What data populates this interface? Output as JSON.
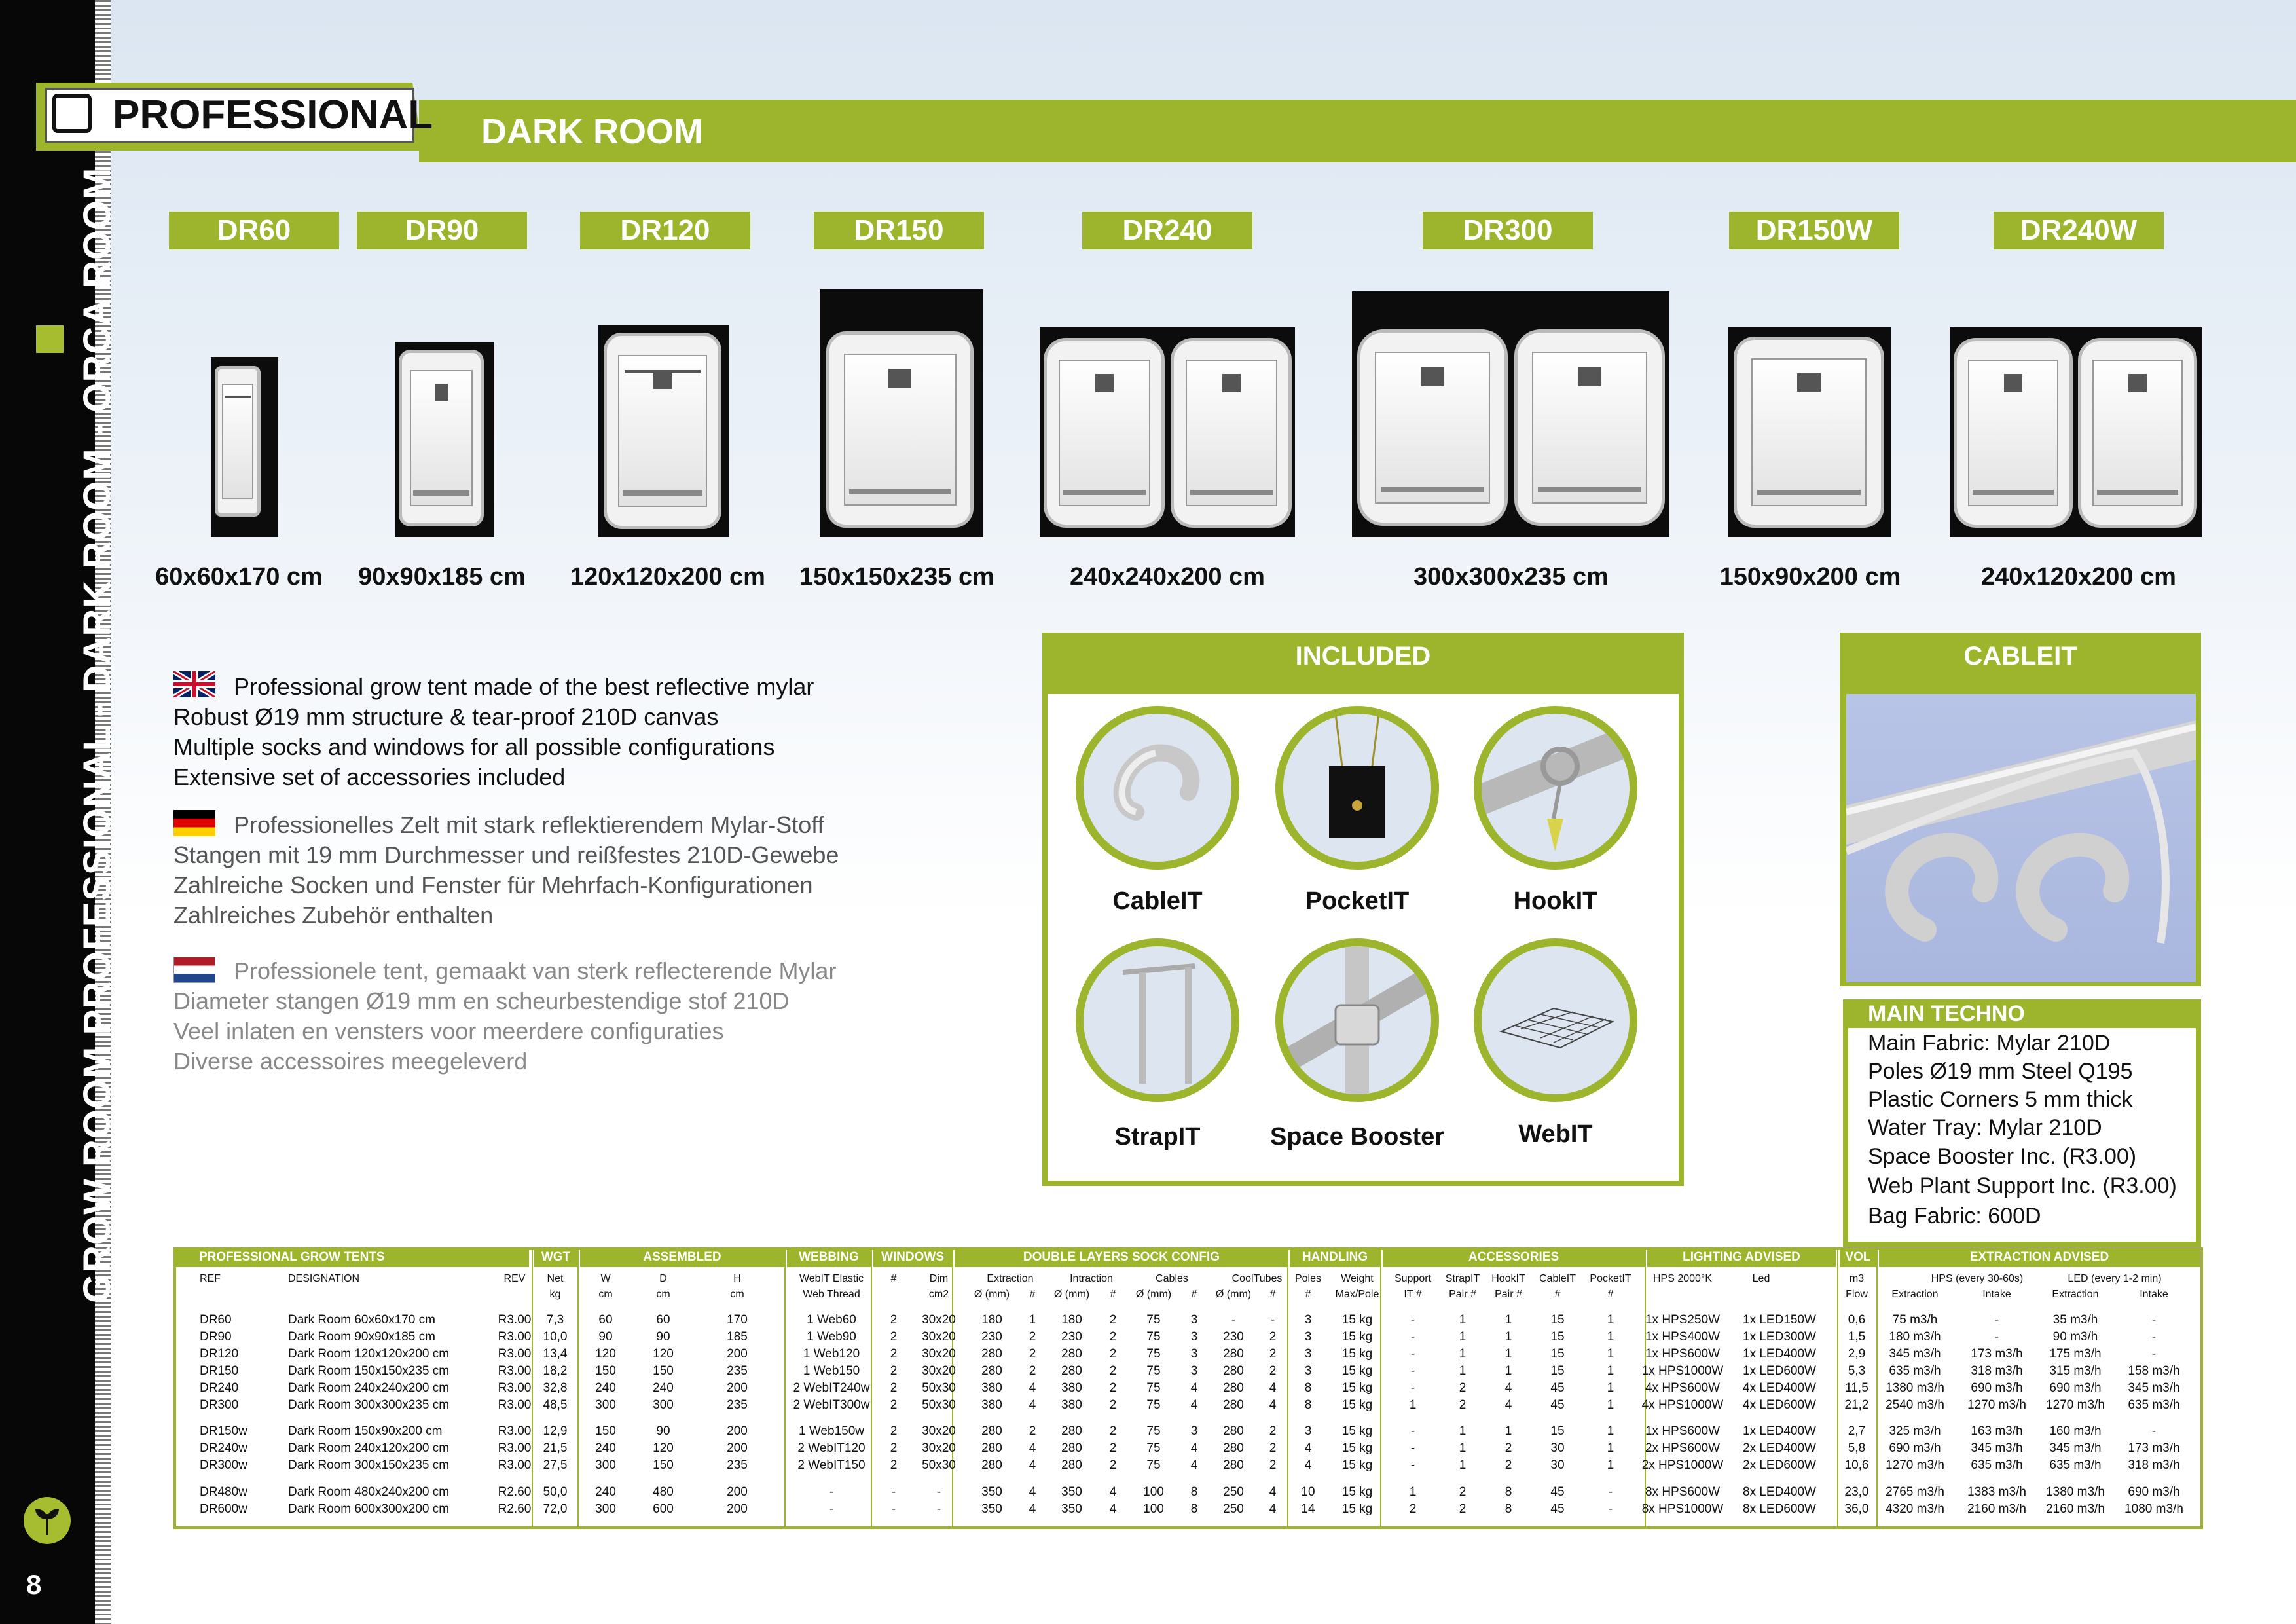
{
  "header": {
    "section": "PROFESSIONAL",
    "title": "DARK ROOM"
  },
  "sidebar": {
    "text": "GROW ROOM PROFESSIONAL - DARK ROOM - ORCA ROOM",
    "page_number": "8"
  },
  "models": [
    {
      "name": "DR60",
      "size": "60x60x170 cm"
    },
    {
      "name": "DR90",
      "size": "90x90x185 cm"
    },
    {
      "name": "DR120",
      "size": "120x120x200 cm"
    },
    {
      "name": "DR150",
      "size": "150x150x235 cm"
    },
    {
      "name": "DR240",
      "size": "240x240x200 cm"
    },
    {
      "name": "DR300",
      "size": "300x300x235 cm"
    },
    {
      "name": "DR150W",
      "size": "150x90x200 cm"
    },
    {
      "name": "DR240W",
      "size": "240x120x200 cm"
    }
  ],
  "description": {
    "en": [
      "Professional grow tent made of the best reflective mylar",
      "Robust Ø19 mm structure & tear-proof 210D canvas",
      "Multiple socks and windows for all possible configurations",
      "Extensive set of accessories included"
    ],
    "de": [
      "Professionelles Zelt mit stark reflektierendem Mylar-Stoff",
      "Stangen mit 19 mm Durchmesser und reißfestes 210D-Gewebe",
      "Zahlreiche Socken und Fenster für Mehrfach-Konfigurationen",
      "Zahlreiches Zubehör enthalten"
    ],
    "nl": [
      "Professionele tent, gemaakt van sterk reflecterende Mylar",
      "Diameter stangen Ø19 mm en scheurbestendige stof 210D",
      "Veel inlaten en vensters voor meerdere configuraties",
      "Diverse accessoires meegeleverd"
    ]
  },
  "included": {
    "title": "INCLUDED",
    "items": [
      "CableIT",
      "PocketIT",
      "HookIT",
      "StrapIT",
      "Space Booster",
      "WebIT"
    ]
  },
  "cableit": {
    "title": "CABLEIT"
  },
  "main_techno": {
    "title": "MAIN TECHNO",
    "items": [
      "Main Fabric: Mylar 210D",
      "Poles Ø19 mm Steel Q195",
      "Plastic Corners 5 mm thick",
      "Water Tray: Mylar 210D",
      "Space Booster Inc. (R3.00)",
      "Web Plant Support Inc. (R3.00)",
      "Bag Fabric: 600D"
    ]
  },
  "table": {
    "groups": [
      "PROFESSIONAL GROW TENTS",
      "WGT",
      "ASSEMBLED",
      "WEBBING",
      "WINDOWS",
      "DOUBLE LAYERS SOCK CONFIG",
      "HANDLING",
      "ACCESSORIES",
      "LIGHTING ADVISED",
      "VOL",
      "EXTRACTION ADVISED"
    ],
    "headers1": [
      "REF",
      "DESIGNATION",
      "REV",
      "Net",
      "W",
      "D",
      "H",
      "WebIT Elastic",
      "#",
      "Dim",
      "Extraction",
      "Intraction",
      "Cables",
      "CoolTubes",
      "Poles",
      "Weight",
      "Support",
      "StrapIT",
      "HookIT",
      "CableIT",
      "PocketIT",
      "HPS 2000°K",
      "Led",
      "m3",
      "HPS (every 30-60s)",
      "LED (every 1-2 min)"
    ],
    "headers2": [
      "kg",
      "cm",
      "cm",
      "cm",
      "Web Thread",
      "cm2",
      "Ø (mm)",
      "#",
      "Ø (mm)",
      "#",
      "Ø (mm)",
      "#",
      "Ø (mm)",
      "#",
      "#",
      "Max/Pole",
      "IT #",
      "Pair #",
      "Pair #",
      "#",
      "#",
      "Flow",
      "Extraction",
      "Intake",
      "Extraction",
      "Intake"
    ],
    "rows": [
      [
        "DR60",
        "Dark Room 60x60x170 cm",
        "R3.00",
        "7,3",
        "60",
        "60",
        "170",
        "1 Web60",
        "2",
        "30x20",
        "180",
        "1",
        "180",
        "2",
        "75",
        "3",
        "-",
        "-",
        "3",
        "15 kg",
        "-",
        "1",
        "1",
        "15",
        "1",
        "1x HPS250W",
        "1x LED150W",
        "0,6",
        "75 m3/h",
        "-",
        "35 m3/h",
        "-"
      ],
      [
        "DR90",
        "Dark Room 90x90x185 cm",
        "R3.00",
        "10,0",
        "90",
        "90",
        "185",
        "1 Web90",
        "2",
        "30x20",
        "230",
        "2",
        "230",
        "2",
        "75",
        "3",
        "230",
        "2",
        "3",
        "15 kg",
        "-",
        "1",
        "1",
        "15",
        "1",
        "1x HPS400W",
        "1x LED300W",
        "1,5",
        "180 m3/h",
        "-",
        "90 m3/h",
        "-"
      ],
      [
        "DR120",
        "Dark Room 120x120x200 cm",
        "R3.00",
        "13,4",
        "120",
        "120",
        "200",
        "1 Web120",
        "2",
        "30x20",
        "280",
        "2",
        "280",
        "2",
        "75",
        "3",
        "280",
        "2",
        "3",
        "15 kg",
        "-",
        "1",
        "1",
        "15",
        "1",
        "1x HPS600W",
        "1x LED400W",
        "2,9",
        "345 m3/h",
        "173 m3/h",
        "175 m3/h",
        "-"
      ],
      [
        "DR150",
        "Dark Room 150x150x235 cm",
        "R3.00",
        "18,2",
        "150",
        "150",
        "235",
        "1 Web150",
        "2",
        "30x20",
        "280",
        "2",
        "280",
        "2",
        "75",
        "3",
        "280",
        "2",
        "3",
        "15 kg",
        "-",
        "1",
        "1",
        "15",
        "1",
        "1x HPS1000W",
        "1x LED600W",
        "5,3",
        "635 m3/h",
        "318 m3/h",
        "315 m3/h",
        "158 m3/h"
      ],
      [
        "DR240",
        "Dark Room 240x240x200 cm",
        "R3.00",
        "32,8",
        "240",
        "240",
        "200",
        "2 WebIT240w",
        "2",
        "50x30",
        "380",
        "4",
        "380",
        "2",
        "75",
        "4",
        "280",
        "4",
        "8",
        "15 kg",
        "-",
        "2",
        "4",
        "45",
        "1",
        "4x HPS600W",
        "4x LED400W",
        "11,5",
        "1380 m3/h",
        "690 m3/h",
        "690 m3/h",
        "345 m3/h"
      ],
      [
        "DR300",
        "Dark Room 300x300x235 cm",
        "R3.00",
        "48,5",
        "300",
        "300",
        "235",
        "2 WebIT300w",
        "2",
        "50x30",
        "380",
        "4",
        "380",
        "2",
        "75",
        "4",
        "280",
        "4",
        "8",
        "15 kg",
        "1",
        "2",
        "4",
        "45",
        "1",
        "4x HPS1000W",
        "4x LED600W",
        "21,2",
        "2540 m3/h",
        "1270 m3/h",
        "1270 m3/h",
        "635 m3/h"
      ],
      [
        "DR150w",
        "Dark Room 150x90x200 cm",
        "R3.00",
        "12,9",
        "150",
        "90",
        "200",
        "1 Web150w",
        "2",
        "30x20",
        "280",
        "2",
        "280",
        "2",
        "75",
        "3",
        "280",
        "2",
        "3",
        "15 kg",
        "-",
        "1",
        "1",
        "15",
        "1",
        "1x HPS600W",
        "1x LED400W",
        "2,7",
        "325 m3/h",
        "163 m3/h",
        "160 m3/h",
        "-"
      ],
      [
        "DR240w",
        "Dark Room 240x120x200 cm",
        "R3.00",
        "21,5",
        "240",
        "120",
        "200",
        "2 WebIT120",
        "2",
        "30x20",
        "280",
        "4",
        "280",
        "2",
        "75",
        "4",
        "280",
        "2",
        "4",
        "15 kg",
        "-",
        "1",
        "2",
        "30",
        "1",
        "2x HPS600W",
        "2x LED400W",
        "5,8",
        "690 m3/h",
        "345 m3/h",
        "345 m3/h",
        "173 m3/h"
      ],
      [
        "DR300w",
        "Dark Room 300x150x235 cm",
        "R3.00",
        "27,5",
        "300",
        "150",
        "235",
        "2 WebIT150",
        "2",
        "50x30",
        "280",
        "4",
        "280",
        "2",
        "75",
        "4",
        "280",
        "2",
        "4",
        "15 kg",
        "-",
        "1",
        "2",
        "30",
        "1",
        "2x HPS1000W",
        "2x LED600W",
        "10,6",
        "1270 m3/h",
        "635 m3/h",
        "635 m3/h",
        "318 m3/h"
      ],
      [
        "DR480w",
        "Dark Room 480x240x200 cm",
        "R2.60",
        "50,0",
        "240",
        "480",
        "200",
        "-",
        "-",
        "-",
        "350",
        "4",
        "350",
        "4",
        "100",
        "8",
        "250",
        "4",
        "10",
        "15 kg",
        "1",
        "2",
        "8",
        "45",
        "-",
        "8x HPS600W",
        "8x LED400W",
        "23,0",
        "2765 m3/h",
        "1383 m3/h",
        "1380 m3/h",
        "690 m3/h"
      ],
      [
        "DR600w",
        "Dark Room 600x300x200 cm",
        "R2.60",
        "72,0",
        "300",
        "600",
        "200",
        "-",
        "-",
        "-",
        "350",
        "4",
        "350",
        "4",
        "100",
        "8",
        "250",
        "4",
        "14",
        "15 kg",
        "2",
        "2",
        "8",
        "45",
        "-",
        "8x HPS1000W",
        "8x LED600W",
        "36,0",
        "4320 m3/h",
        "2160 m3/h",
        "2160 m3/h",
        "1080 m3/h"
      ]
    ]
  },
  "colors": {
    "accent": "#9cb52c",
    "sidebar": "#070707"
  }
}
